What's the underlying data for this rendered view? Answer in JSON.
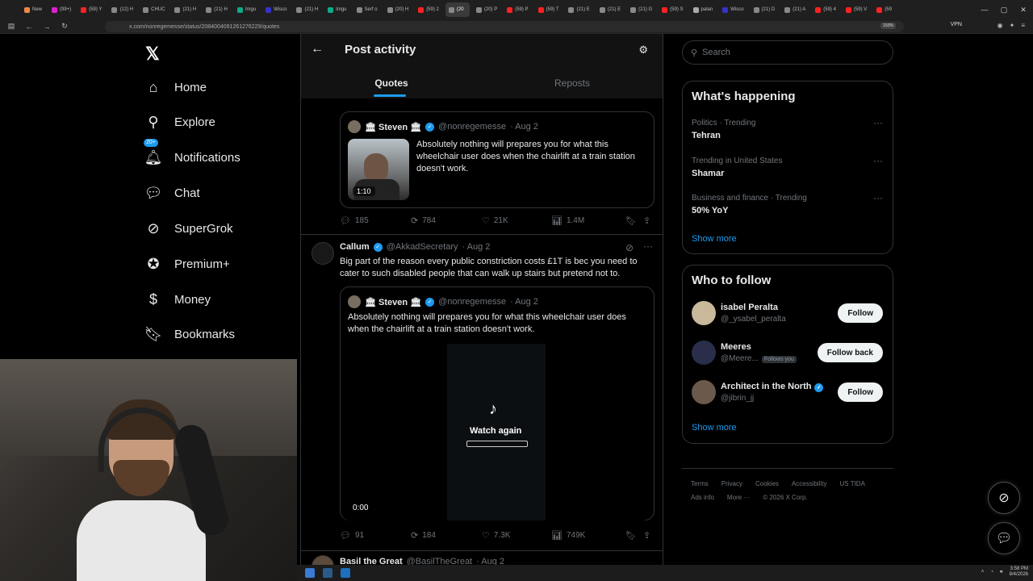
{
  "browser": {
    "tabs": [
      {
        "label": "New",
        "color": "#e84"
      },
      {
        "label": "(99+)",
        "color": "#d2c"
      },
      {
        "label": "(59) Y",
        "color": "#f22"
      },
      {
        "label": "(12) H",
        "color": "#888"
      },
      {
        "label": "CHUC",
        "color": "#888"
      },
      {
        "label": "(21) H",
        "color": "#888"
      },
      {
        "label": "(21) H",
        "color": "#888"
      },
      {
        "label": "Imgu",
        "color": "#1a8"
      },
      {
        "label": "Wisco",
        "color": "#33c"
      },
      {
        "label": "(21) H",
        "color": "#888"
      },
      {
        "label": "Imgu",
        "color": "#1a8"
      },
      {
        "label": "Serf o",
        "color": "#888"
      },
      {
        "label": "(20) H",
        "color": "#888"
      },
      {
        "label": "(59) 2",
        "color": "#f22"
      },
      {
        "label": "(20",
        "color": "#888"
      },
      {
        "label": "(20) P",
        "color": "#888"
      },
      {
        "label": "(59) P",
        "color": "#f22"
      },
      {
        "label": "(59) T",
        "color": "#f22"
      },
      {
        "label": "(21) E",
        "color": "#888"
      },
      {
        "label": "(21) E",
        "color": "#888"
      },
      {
        "label": "(21) G",
        "color": "#888"
      },
      {
        "label": "(59) S",
        "color": "#f22"
      },
      {
        "label": "palan",
        "color": "#aaa"
      },
      {
        "label": "Wisco",
        "color": "#33c"
      },
      {
        "label": "(21) D",
        "color": "#888"
      },
      {
        "label": "(21) A",
        "color": "#888"
      },
      {
        "label": "(59) 4",
        "color": "#f22"
      },
      {
        "label": "(59) V",
        "color": "#f22"
      },
      {
        "label": "(59",
        "color": "#f22"
      }
    ],
    "active_tab_index": 14,
    "url": "x.com/nonregemesse/status/2084004091261276229/quotes",
    "zoom": "150%",
    "vpn": "VPN"
  },
  "nav": {
    "items": [
      {
        "label": "Home",
        "icon": "⌂"
      },
      {
        "label": "Explore",
        "icon": "⚲"
      },
      {
        "label": "Notifications",
        "icon": "🔔︎",
        "badge": "20+"
      },
      {
        "label": "Chat",
        "icon": "💬︎"
      },
      {
        "label": "SuperGrok",
        "icon": "⊘"
      },
      {
        "label": "Premium+",
        "icon": "✪"
      },
      {
        "label": "Money",
        "icon": "$"
      },
      {
        "label": "Bookmarks",
        "icon": "🔖︎"
      }
    ]
  },
  "header": {
    "title": "Post activity",
    "tabs": [
      "Quotes",
      "Reposts"
    ]
  },
  "post1": {
    "quoted": {
      "name": "🏛 Steven 🏛",
      "handle": "@nonregemesse",
      "date": "· Aug 2",
      "text": "Absolutely nothing will prepares you for what this wheelchair user does when the chairlift at a train station doesn't work.",
      "duration": "1:10"
    },
    "stats": {
      "replies": "185",
      "reposts": "784",
      "likes": "21K",
      "views": "1.4M"
    }
  },
  "post2": {
    "name": "Callum",
    "handle": "@AkkadSecretary",
    "date": "· Aug 2",
    "text": "Big part of the reason every public constriction costs £1T is bec you need to cater to such disabled people that can walk up stairs but pretend not to.",
    "quoted": {
      "name": "🏛 Steven 🏛",
      "handle": "@nonregemesse",
      "date": "· Aug 2",
      "text": "Absolutely nothing will prepares you for what this wheelchair user does when the chairlift at a train station doesn't work.",
      "watch_again": "Watch again",
      "time": "0:00"
    },
    "stats": {
      "replies": "91",
      "reposts": "184",
      "likes": "7.3K",
      "views": "749K"
    }
  },
  "post3": {
    "name": "Basil the Great",
    "handle": "@BasilTheGreat",
    "date": "· Aug 2"
  },
  "sidebar": {
    "search_placeholder": "Search",
    "happening": {
      "title": "What's happening",
      "trends": [
        {
          "meta": "Politics · Trending",
          "name": "Tehran"
        },
        {
          "meta": "Trending in United States",
          "name": "Shamar"
        },
        {
          "meta": "Business and finance · Trending",
          "name": "50% YoY"
        }
      ],
      "show_more": "Show more"
    },
    "who_to_follow": {
      "title": "Who to follow",
      "users": [
        {
          "name": "isabel Peralta",
          "handle": "@_ysabel_peralta",
          "button": "Follow",
          "avatar_color": "#c9b89a"
        },
        {
          "name": "Meeres",
          "handle": "@Meere...",
          "follows_you": "Follows you",
          "button": "Follow back",
          "avatar_color": "#2a2e4a"
        },
        {
          "name": "Architect in the North",
          "handle": "@jibrin_jj",
          "button": "Follow",
          "verified": true,
          "avatar_color": "#6b5a4c"
        }
      ],
      "show_more": "Show more"
    },
    "footer": [
      "Terms",
      "Privacy",
      "Cookies",
      "Accessibility",
      "US TIDA",
      "Ads info",
      "More ···",
      "© 2026 X Corp."
    ]
  },
  "taskbar": {
    "time": "3:58 PM",
    "date": "8/4/2026"
  }
}
